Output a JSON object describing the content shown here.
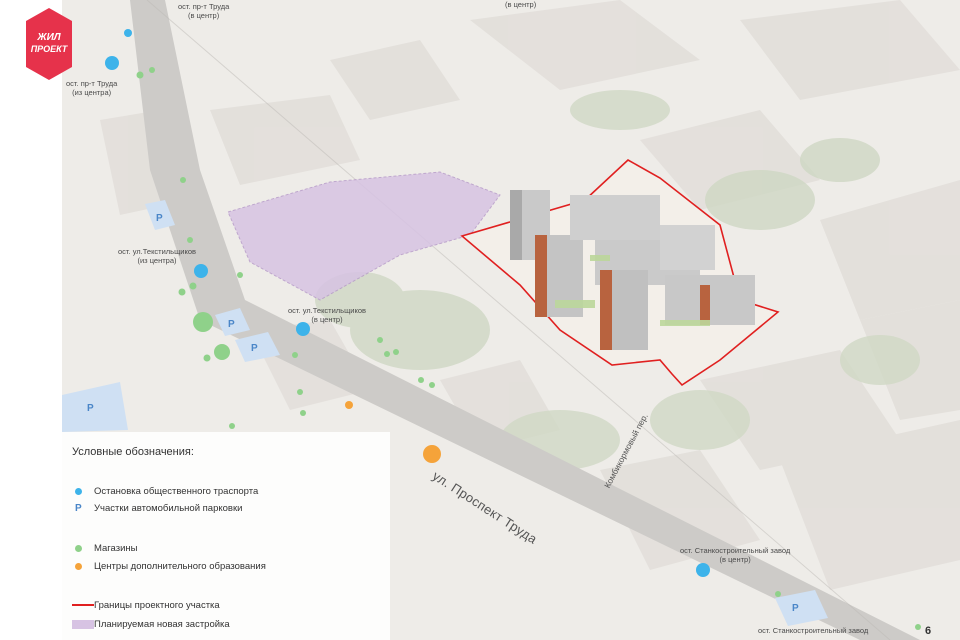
{
  "logo": {
    "line1": "ЖИЛ",
    "line2": "ПРОЕКТ",
    "color": "#e6324b"
  },
  "streets": {
    "main": "ул. Проспект Труда",
    "side": "Комбикормовый пер."
  },
  "stops": {
    "trud_to_center_top": "ост. пр-т Труда\n(в центр)",
    "top_right": "(в центр)",
    "trud_from_center": "ост. пр-т Труда\n(из центра)",
    "textile_from_center": "ост. ул.Текстильщиков\n(из центра)",
    "textile_to_center": "ост. ул.Текстильщиков\n(в центр)",
    "machine_plant_to_center": "ост. Станкостроительный завод\n(в центр)",
    "machine_plant_bottom": "ост. Станкостроительный завод"
  },
  "parking_label": "P",
  "legend": {
    "title": "Условные обозначения:",
    "items": [
      {
        "label": "Остановка общественного траспорта",
        "color": "#3db3ea"
      },
      {
        "label": "Участки автомобильной парковки",
        "color": "#4a86c8"
      },
      {
        "label": "Магазины",
        "color": "#8fd18a"
      },
      {
        "label": "Центры дополнительного образования",
        "color": "#f5a33a"
      },
      {
        "label": "Границы проектного участка",
        "color": "#e02020"
      },
      {
        "label": "Планируемая новая застройка",
        "color": "#d7c3e3"
      }
    ]
  },
  "page_number": "6"
}
